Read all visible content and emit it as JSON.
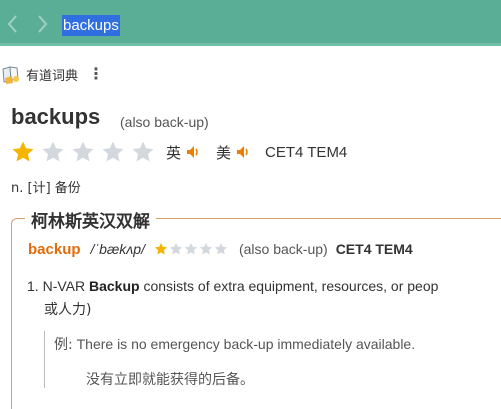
{
  "search": {
    "query": "backups"
  },
  "nav": {
    "back_icon": "chevron-left-icon",
    "forward_icon": "chevron-right-icon"
  },
  "source": {
    "name": "有道词典",
    "icon": "book-icon",
    "more_icon": "more-vertical-icon"
  },
  "entry": {
    "word": "backups",
    "also": "(also back-up)",
    "rating": {
      "filled": 1,
      "total": 5
    },
    "pron_uk_label": "英",
    "pron_us_label": "美",
    "levels": "CET4 TEM4",
    "basic_definition": "n. [计] 备份"
  },
  "collins": {
    "title": "柯林斯英汉双解",
    "word": "backup",
    "phonetic": "/ˈbækʌp/",
    "rating": {
      "filled": 1,
      "total": 5
    },
    "also": "(also back-up)",
    "levels": "CET4 TEM4",
    "sense": {
      "number": "1.",
      "pos": "N-VAR",
      "headword": "Backup",
      "definition": "consists of extra equipment, resources, or peop",
      "translation": "或人力)"
    },
    "example": {
      "label": "例:",
      "en": "There is no emergency back-up immediately available.",
      "zh": "没有立即就能获得的后备。"
    }
  },
  "colors": {
    "topbar": "#5aae95",
    "selection": "#2f6fe0",
    "accent_orange": "#e36c0a",
    "star_filled": "#f5b400",
    "star_empty": "#d3d8de",
    "box_border": "#d7a06a"
  }
}
